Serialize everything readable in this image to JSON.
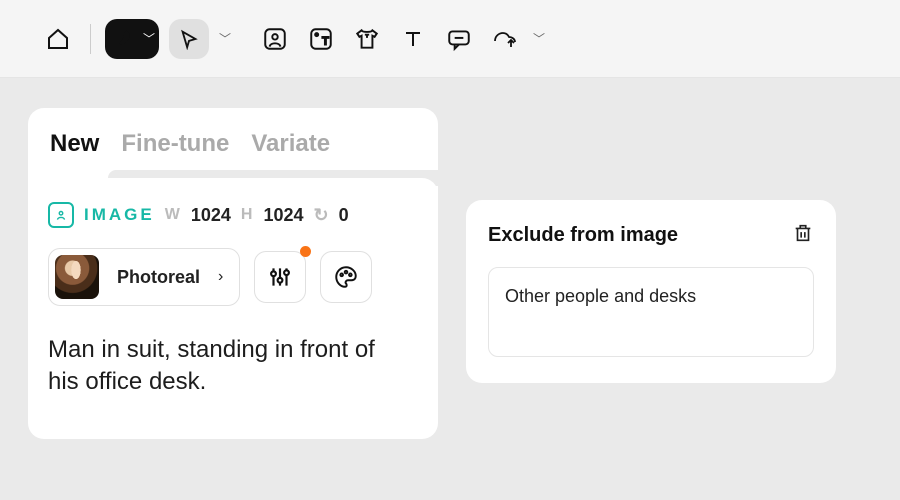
{
  "toolbar": {
    "home": "home-icon",
    "brush": "brush-icon",
    "pointer": "pointer-icon",
    "portrait": "portrait-icon",
    "typebox": "type-box-icon",
    "tshirt": "tshirt-icon",
    "text": "text-icon",
    "chat": "chat-icon",
    "upload": "image-upload-icon"
  },
  "tabs": {
    "new": "New",
    "fine_tune": "Fine-tune",
    "variate": "Variate"
  },
  "meta": {
    "label": "IMAGE",
    "w_label": "W",
    "w_value": "1024",
    "h_label": "H",
    "h_value": "1024",
    "rot_value": "0"
  },
  "style": {
    "name": "Photoreal"
  },
  "prompt": {
    "text": "Man in suit, standing in front of his office desk."
  },
  "exclude": {
    "title": "Exclude from image",
    "text": "Other people and desks"
  }
}
